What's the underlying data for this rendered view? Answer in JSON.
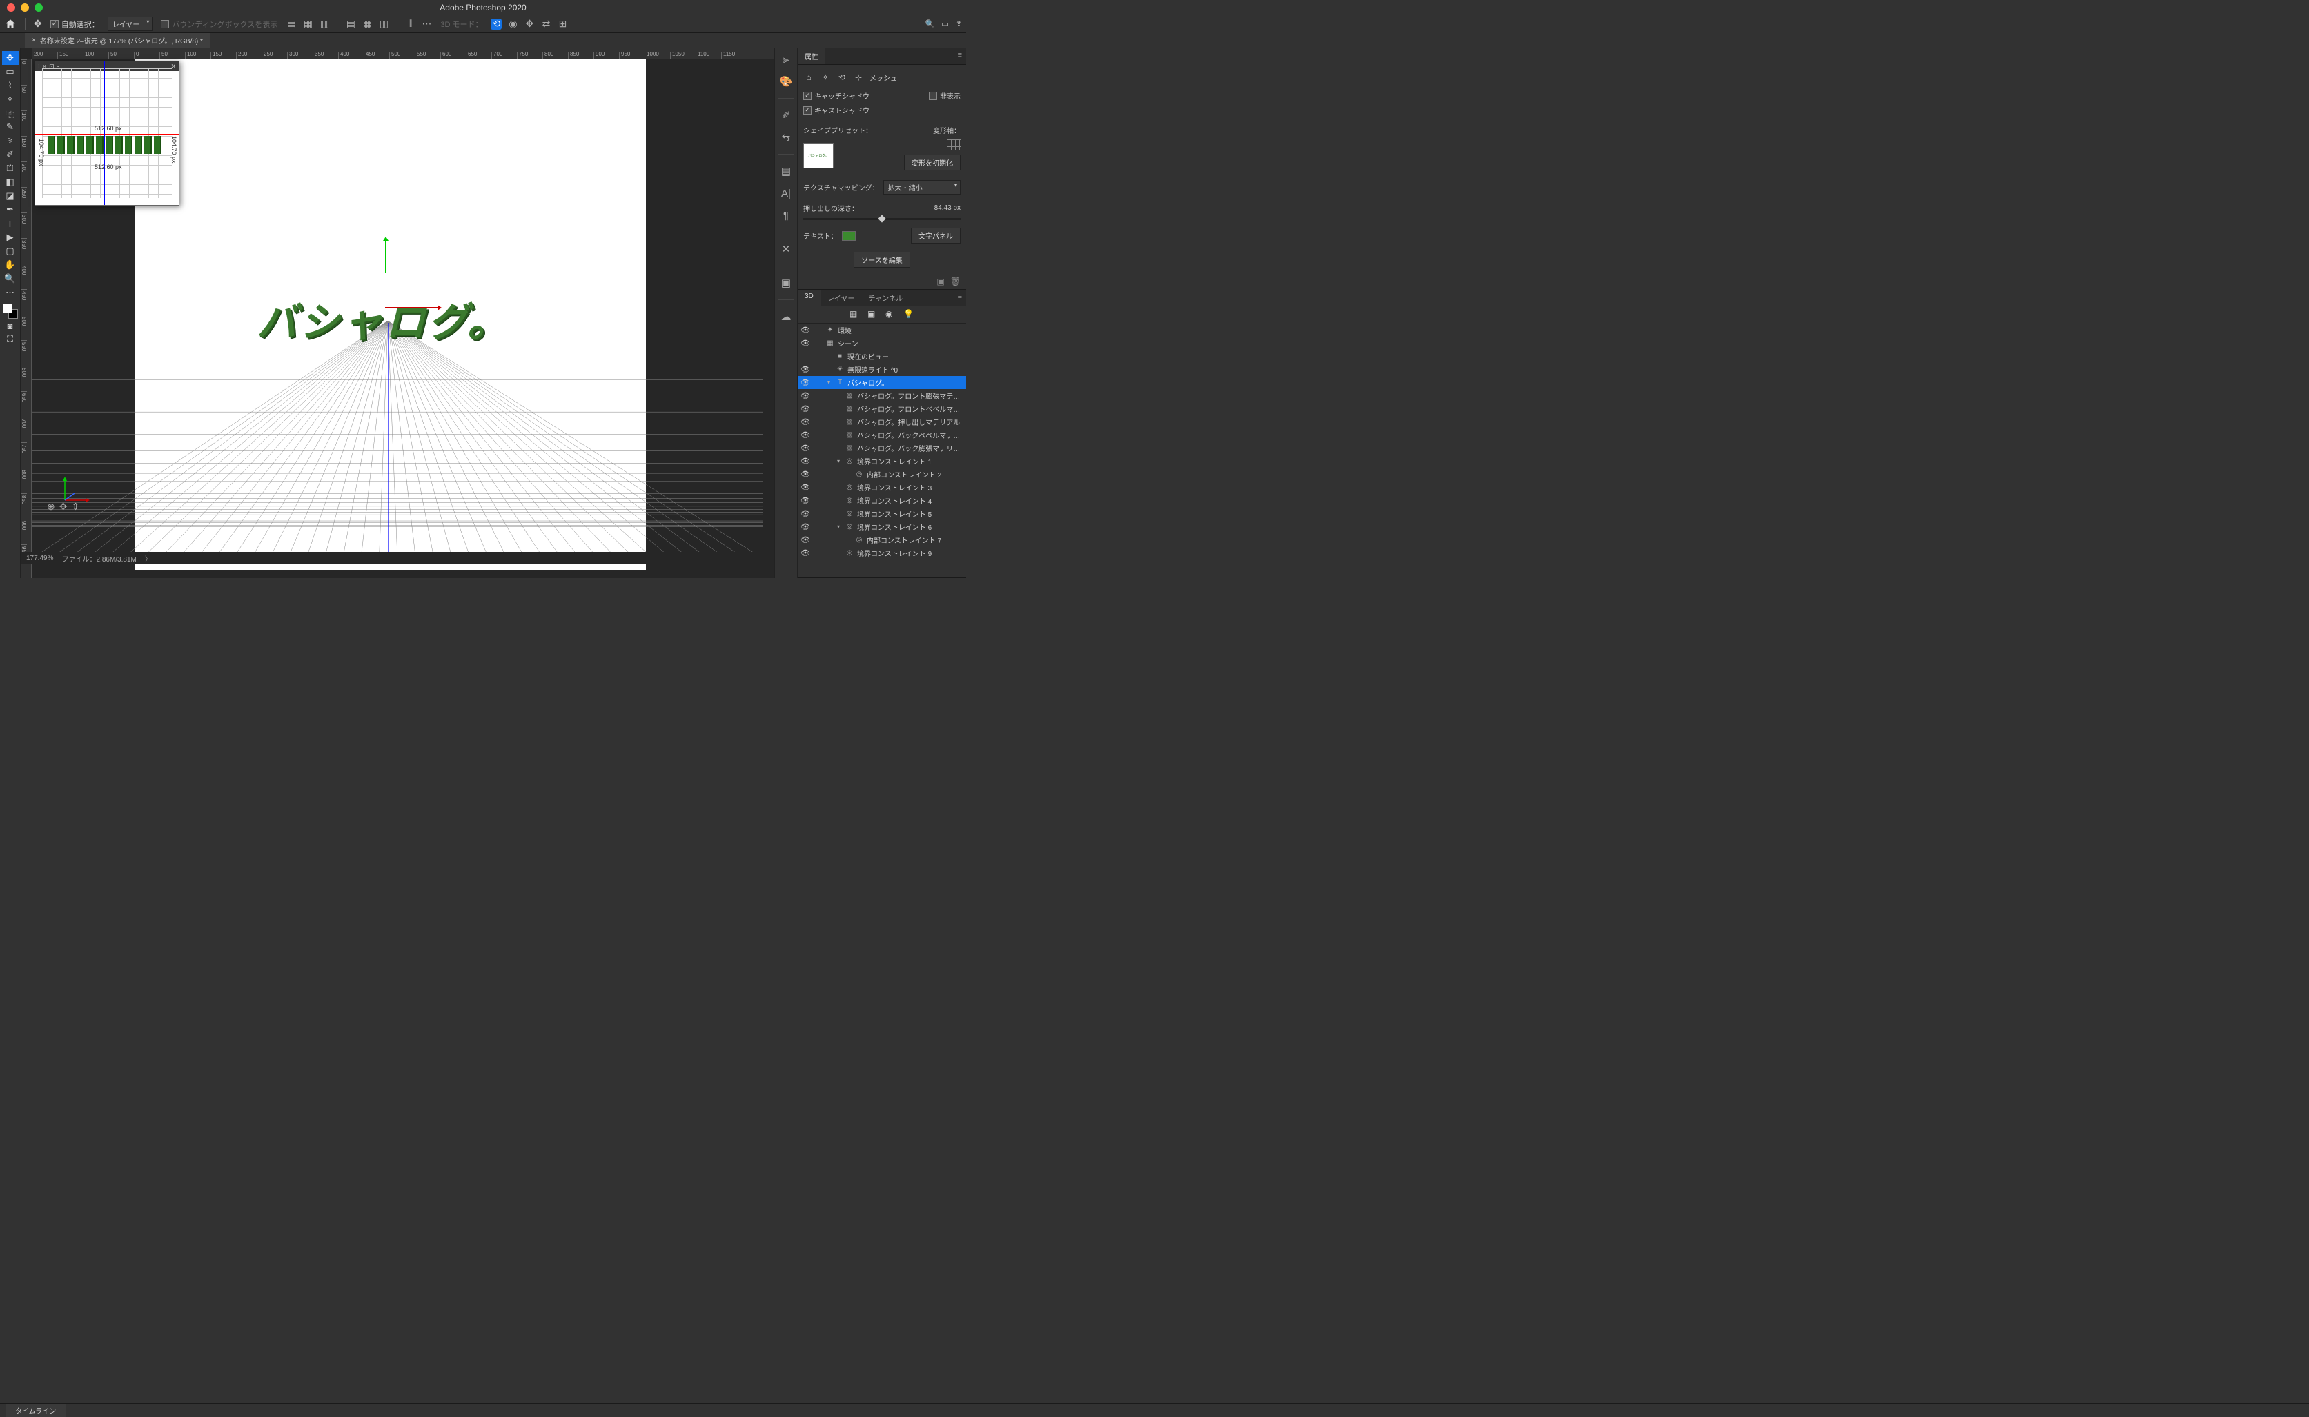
{
  "app": {
    "title": "Adobe Photoshop 2020"
  },
  "menubar": {
    "auto_select_label": "自動選択：",
    "auto_select_value": "レイヤー",
    "bounding_box_label": "バウンディングボックスを表示",
    "mode_3d_label": "3D モード："
  },
  "tab": {
    "title": "名称未設定 2–復元 @ 177% (バシャログ。, RGB/8) *"
  },
  "ruler_values": [
    "200",
    "150",
    "100",
    "50",
    "0",
    "50",
    "100",
    "150",
    "200",
    "250",
    "300",
    "350",
    "400",
    "450",
    "500",
    "550",
    "600",
    "650",
    "700",
    "750",
    "800",
    "850",
    "900",
    "950",
    "1000",
    "1050",
    "1100",
    "1150"
  ],
  "ruler_v_values": [
    "0",
    "5",
    "1",
    "0",
    "0",
    "1",
    "5",
    "0",
    "2",
    "0",
    "0",
    "2",
    "5",
    "0",
    "3",
    "0",
    "0",
    "3",
    "5",
    "0",
    "4",
    "0",
    "0",
    "4",
    "5",
    "0",
    "5",
    "0",
    "0",
    "5",
    "5",
    "0",
    "6",
    "0",
    "0",
    "6",
    "5",
    "0",
    "7",
    "0",
    "0",
    "7",
    "5",
    "0",
    "8",
    "0",
    "0",
    "8",
    "5",
    "0",
    "9",
    "0",
    "0",
    "9",
    "5",
    "0"
  ],
  "canvas": {
    "text": "バシャログ。"
  },
  "navigator": {
    "dim_top": "512.60 px",
    "dim_bot": "512.60 px",
    "dim_left": "104.70 px",
    "dim_right": "104.70 px"
  },
  "status": {
    "zoom": "177.49%",
    "file": "ファイル：2.86M/3.81M"
  },
  "timeline": {
    "label": "タイムライン"
  },
  "properties": {
    "title": "属性",
    "mesh_label": "メッシュ",
    "catch_shadow": "キャッチシャドウ",
    "hide_label": "非表示",
    "cast_shadow": "キャストシャドウ",
    "shape_preset_label": "シェイププリセット：",
    "deform_axis_label": "変形軸：",
    "reset_deform": "変形を初期化",
    "texture_mapping_label": "テクスチャマッピング：",
    "texture_mapping_value": "拡大・縮小",
    "extrude_depth_label": "押し出しの深さ：",
    "extrude_depth_value": "84.43 px",
    "text_label": "テキスト：",
    "char_panel": "文字パネル",
    "edit_source": "ソースを編集"
  },
  "threeD": {
    "tabs": {
      "threeD": "3D",
      "layers": "レイヤー",
      "channels": "チャンネル"
    },
    "tree": [
      {
        "eye": true,
        "indent": 0,
        "toggle": "",
        "icon": "✦",
        "label": "環境",
        "sel": false
      },
      {
        "eye": true,
        "indent": 0,
        "toggle": "",
        "icon": "▦",
        "label": "シーン",
        "sel": false
      },
      {
        "eye": false,
        "indent": 1,
        "toggle": "",
        "icon": "■",
        "label": "現在のビュー",
        "sel": false
      },
      {
        "eye": true,
        "indent": 1,
        "toggle": "",
        "icon": "☀",
        "label": "無限遠ライト ^0",
        "sel": false
      },
      {
        "eye": true,
        "indent": 1,
        "toggle": "▾",
        "icon": "T",
        "label": "バシャログ。",
        "sel": true
      },
      {
        "eye": true,
        "indent": 2,
        "toggle": "",
        "icon": "▨",
        "label": "バシャログ。フロント膨張マテリアル",
        "sel": false
      },
      {
        "eye": true,
        "indent": 2,
        "toggle": "",
        "icon": "▨",
        "label": "バシャログ。フロントベベルマテリアル",
        "sel": false
      },
      {
        "eye": true,
        "indent": 2,
        "toggle": "",
        "icon": "▨",
        "label": "バシャログ。押し出しマテリアル",
        "sel": false
      },
      {
        "eye": true,
        "indent": 2,
        "toggle": "",
        "icon": "▨",
        "label": "バシャログ。バックベベルマテリアル",
        "sel": false
      },
      {
        "eye": true,
        "indent": 2,
        "toggle": "",
        "icon": "▨",
        "label": "バシャログ。バック膨張マテリアル",
        "sel": false
      },
      {
        "eye": true,
        "indent": 2,
        "toggle": "▾",
        "icon": "◎",
        "label": "境界コンストレイント 1",
        "sel": false
      },
      {
        "eye": true,
        "indent": 3,
        "toggle": "",
        "icon": "◎",
        "label": "内部コンストレイント 2",
        "sel": false
      },
      {
        "eye": true,
        "indent": 2,
        "toggle": "",
        "icon": "◎",
        "label": "境界コンストレイント 3",
        "sel": false
      },
      {
        "eye": true,
        "indent": 2,
        "toggle": "",
        "icon": "◎",
        "label": "境界コンストレイント 4",
        "sel": false
      },
      {
        "eye": true,
        "indent": 2,
        "toggle": "",
        "icon": "◎",
        "label": "境界コンストレイント 5",
        "sel": false
      },
      {
        "eye": true,
        "indent": 2,
        "toggle": "▾",
        "icon": "◎",
        "label": "境界コンストレイント 6",
        "sel": false
      },
      {
        "eye": true,
        "indent": 3,
        "toggle": "",
        "icon": "◎",
        "label": "内部コンストレイント 7",
        "sel": false
      },
      {
        "eye": true,
        "indent": 2,
        "toggle": "",
        "icon": "◎",
        "label": "境界コンストレイント 9",
        "sel": false
      }
    ]
  }
}
